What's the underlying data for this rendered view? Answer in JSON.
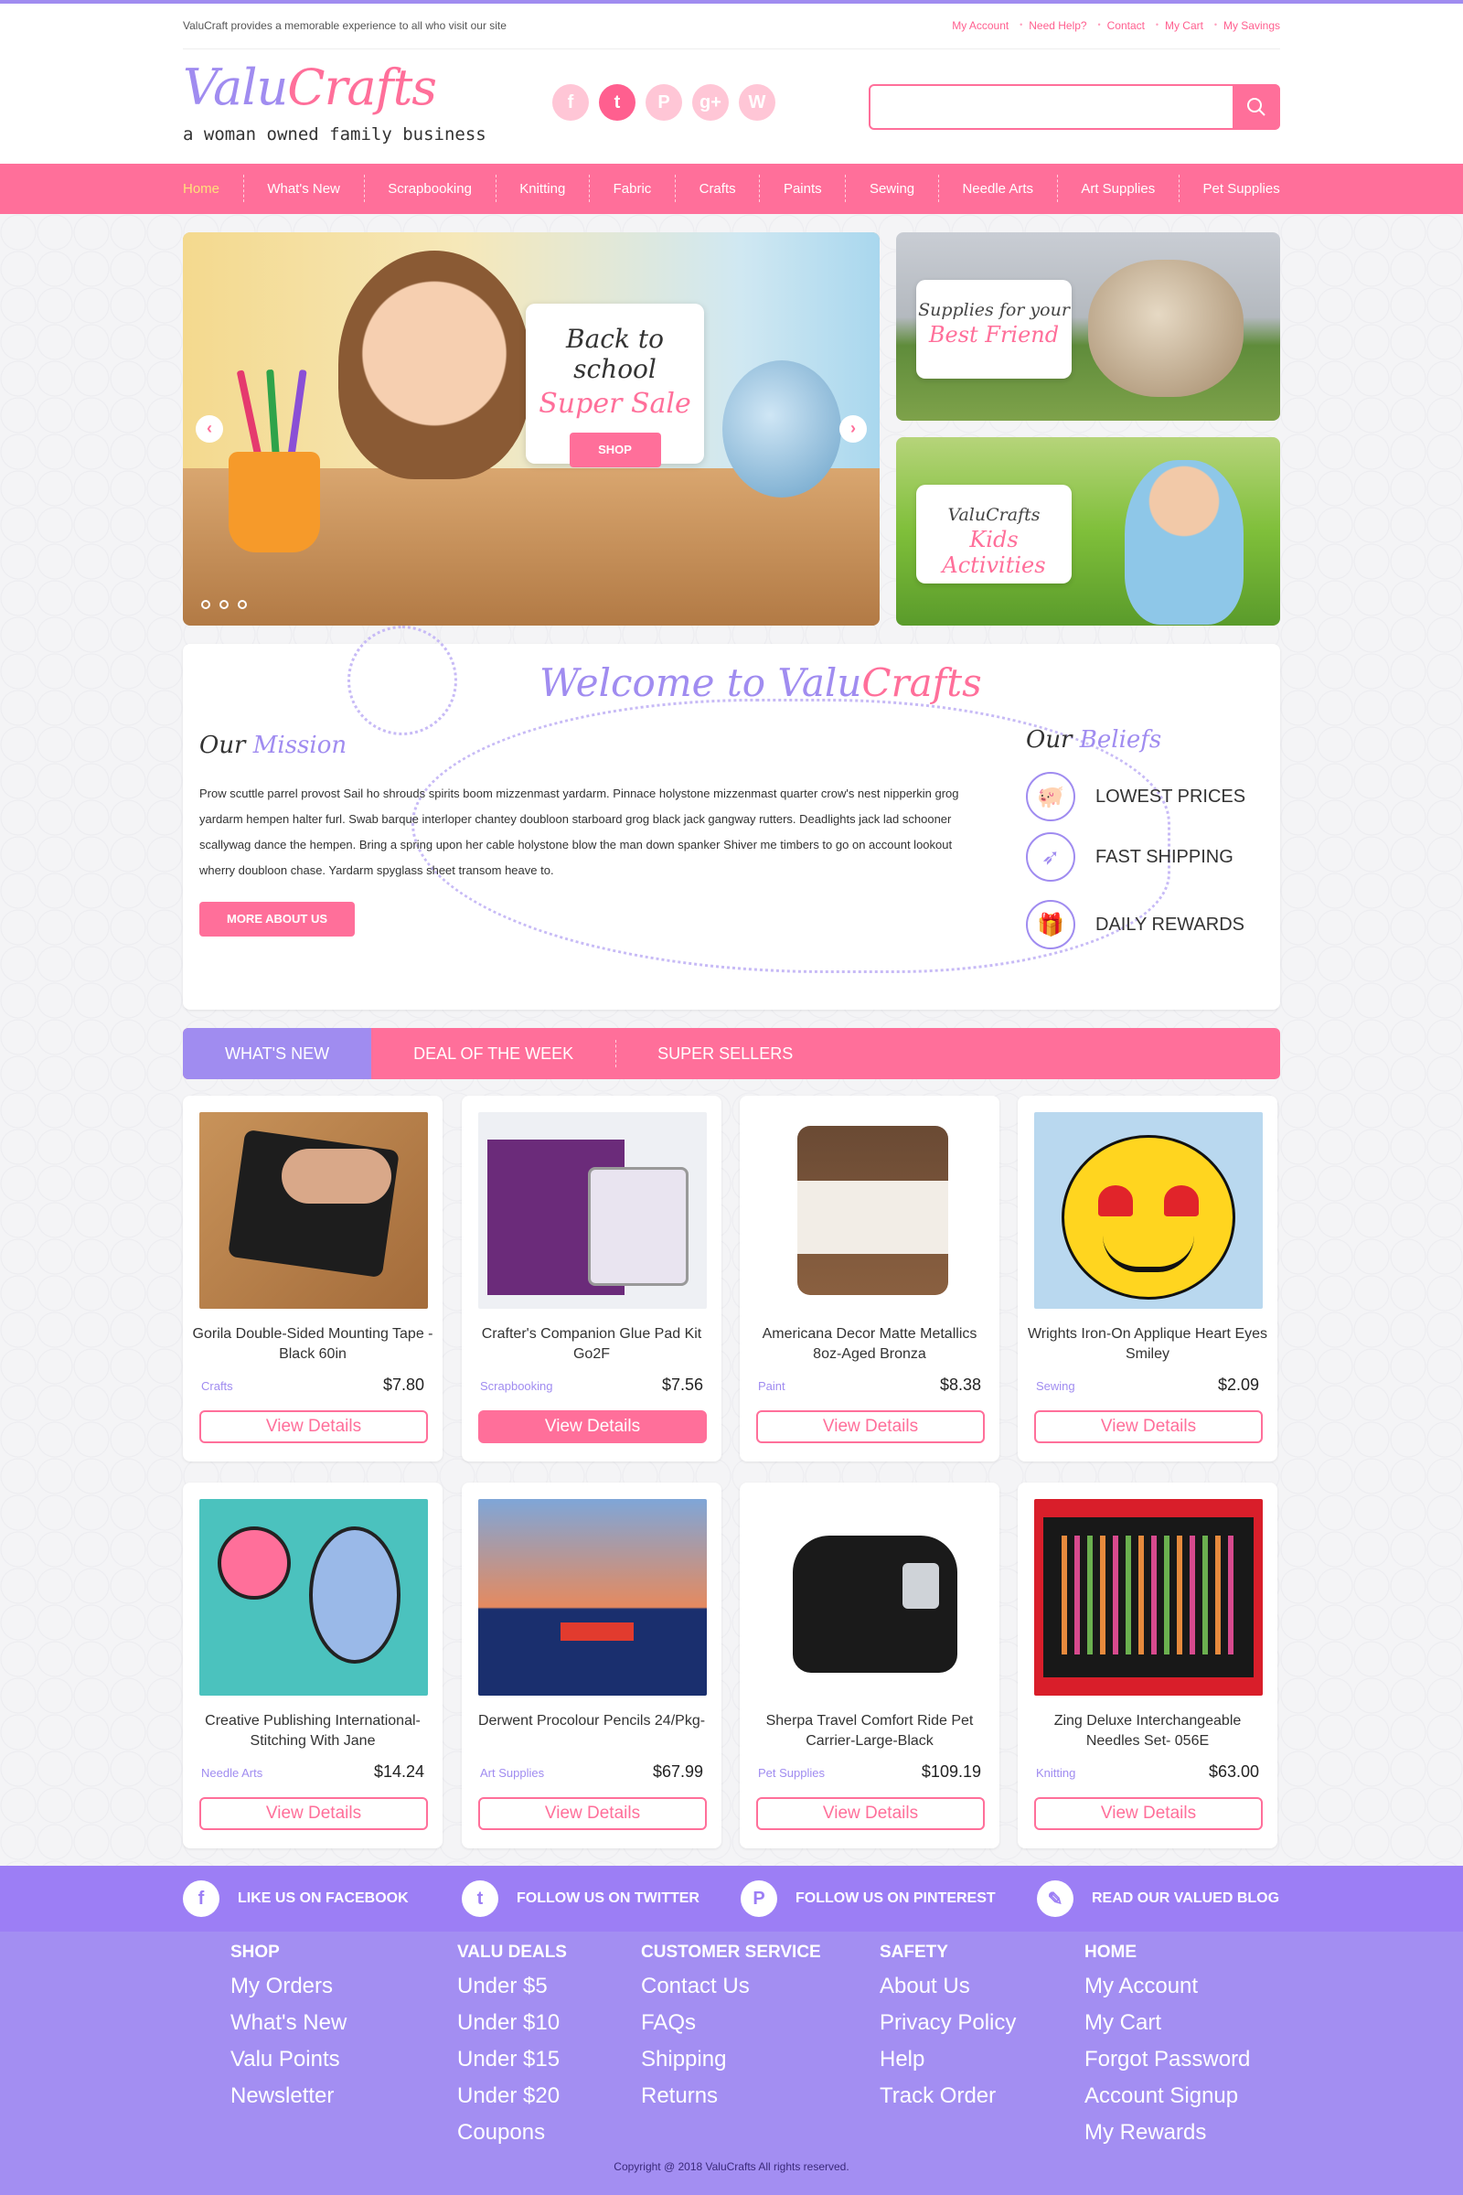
{
  "topbar": {
    "tagline": "ValuCraft provides a memorable experience to all who visit our site",
    "links": [
      "My Account",
      "Need Help?",
      "Contact",
      "My Cart",
      "My Savings"
    ]
  },
  "header": {
    "logo_part1": "Valu",
    "logo_part2": "Crafts",
    "logo_sub": "a woman owned family business",
    "socials": [
      {
        "icon": "facebook-icon",
        "glyph": "f"
      },
      {
        "icon": "twitter-icon",
        "glyph": "t"
      },
      {
        "icon": "pinterest-icon",
        "glyph": "P"
      },
      {
        "icon": "google-plus-icon",
        "glyph": "g+"
      },
      {
        "icon": "wordpress-icon",
        "glyph": "W"
      }
    ],
    "search_value": ""
  },
  "nav": [
    "Home",
    "What's New",
    "Scrapbooking",
    "Knitting",
    "Fabric",
    "Crafts",
    "Paints",
    "Sewing",
    "Needle Arts",
    "Art Supplies",
    "Pet Supplies"
  ],
  "hero": {
    "line1": "Back to school",
    "line2": "Super Sale",
    "button": "SHOP",
    "prev": "‹",
    "next": "›"
  },
  "side_banners": [
    {
      "line1": "Supplies for your",
      "line2": "Best Friend"
    },
    {
      "line1": "ValuCrafts",
      "line2": "Kids Activities"
    }
  ],
  "welcome": {
    "title_part1": "Welcome to Valu",
    "title_part2": "Crafts",
    "mission_h1": "Our ",
    "mission_h2": "Mission",
    "mission_text": "Prow scuttle parrel provost Sail ho shrouds spirits boom mizzenmast yardarm. Pinnace holystone mizzenmast quarter crow's nest nipperkin grog yardarm hempen halter furl. Swab barque interloper chantey doubloon starboard grog black jack gangway rutters. Deadlights jack lad schooner scallywag dance the hempen. Bring a spring upon her cable holystone blow the man down spanker Shiver me timbers to go on account lookout wherry doubloon chase. Yardarm spyglass sheet transom heave to.",
    "more_button": "MORE ABOUT US",
    "beliefs_h1": "Our ",
    "beliefs_h2": "Beliefs",
    "beliefs": [
      {
        "icon": "piggy-bank-icon",
        "glyph": "🐖",
        "label": "LOWEST PRICES"
      },
      {
        "icon": "rocket-icon",
        "glyph": "➶",
        "label": "FAST SHIPPING"
      },
      {
        "icon": "gift-icon",
        "glyph": "🎁",
        "label": "DAILY REWARDS"
      }
    ]
  },
  "tabs": [
    "WHAT'S NEW",
    "DEAL OF THE WEEK",
    "SUPER SELLERS"
  ],
  "products": [
    {
      "name": "Gorila Double-Sided Mounting Tape - Black 60in",
      "category": "Crafts",
      "price": "$7.80",
      "button": "View Details"
    },
    {
      "name": "Crafter's Companion Glue Pad Kit Go2F",
      "category": "Scrapbooking",
      "price": "$7.56",
      "button": "View Details"
    },
    {
      "name": "Americana Decor Matte Metallics 8oz-Aged Bronza",
      "category": "Paint",
      "price": "$8.38",
      "button": "View Details"
    },
    {
      "name": "Wrights Iron-On Applique Heart Eyes Smiley",
      "category": "Sewing",
      "price": "$2.09",
      "button": "View Details"
    },
    {
      "name": "Creative Publishing International-Stitching With Jane",
      "category": "Needle Arts",
      "price": "$14.24",
      "button": "View Details"
    },
    {
      "name": "Derwent Procolour Pencils 24/Pkg-",
      "category": "Art Supplies",
      "price": "$67.99",
      "button": "View Details"
    },
    {
      "name": "Sherpa Travel Comfort Ride Pet Carrier-Large-Black",
      "category": "Pet Supplies",
      "price": "$109.19",
      "button": "View Details"
    },
    {
      "name": "Zing Deluxe Interchangeable Needles Set- 056E",
      "category": "Knitting",
      "price": "$63.00",
      "button": "View Details"
    }
  ],
  "social_strip": [
    {
      "icon": "facebook-icon",
      "glyph": "f",
      "label": "LIKE US ON FACEBOOK"
    },
    {
      "icon": "twitter-icon",
      "glyph": "t",
      "label": "FOLLOW US ON TWITTER"
    },
    {
      "icon": "pinterest-icon",
      "glyph": "P",
      "label": "FOLLOW US ON PINTEREST"
    },
    {
      "icon": "pencil-icon",
      "glyph": "✎",
      "label": "READ OUR VALUED BLOG"
    }
  ],
  "footer": [
    {
      "heading": "SHOP",
      "links": [
        "My Orders",
        "What's New",
        "Valu Points",
        "Newsletter"
      ]
    },
    {
      "heading": "VALU DEALS",
      "links": [
        "Under $5",
        "Under $10",
        "Under $15",
        "Under $20",
        "Coupons"
      ]
    },
    {
      "heading": "CUSTOMER SERVICE",
      "links": [
        "Contact Us",
        "FAQs",
        "Shipping",
        "Returns"
      ]
    },
    {
      "heading": "SAFETY",
      "links": [
        "About Us",
        "Privacy Policy",
        "Help",
        "Track Order"
      ]
    },
    {
      "heading": "HOME",
      "links": [
        "My Account",
        "My Cart",
        "Forgot Password",
        "Account Signup",
        "My Rewards"
      ]
    }
  ],
  "copyright": "Copyright @ 2018 ValuCrafts All rights reserved.",
  "colors": {
    "pink": "#ff6f9a",
    "purple": "#a08cf0",
    "strip": "#9c7ef5",
    "footer": "#a38ef2"
  }
}
